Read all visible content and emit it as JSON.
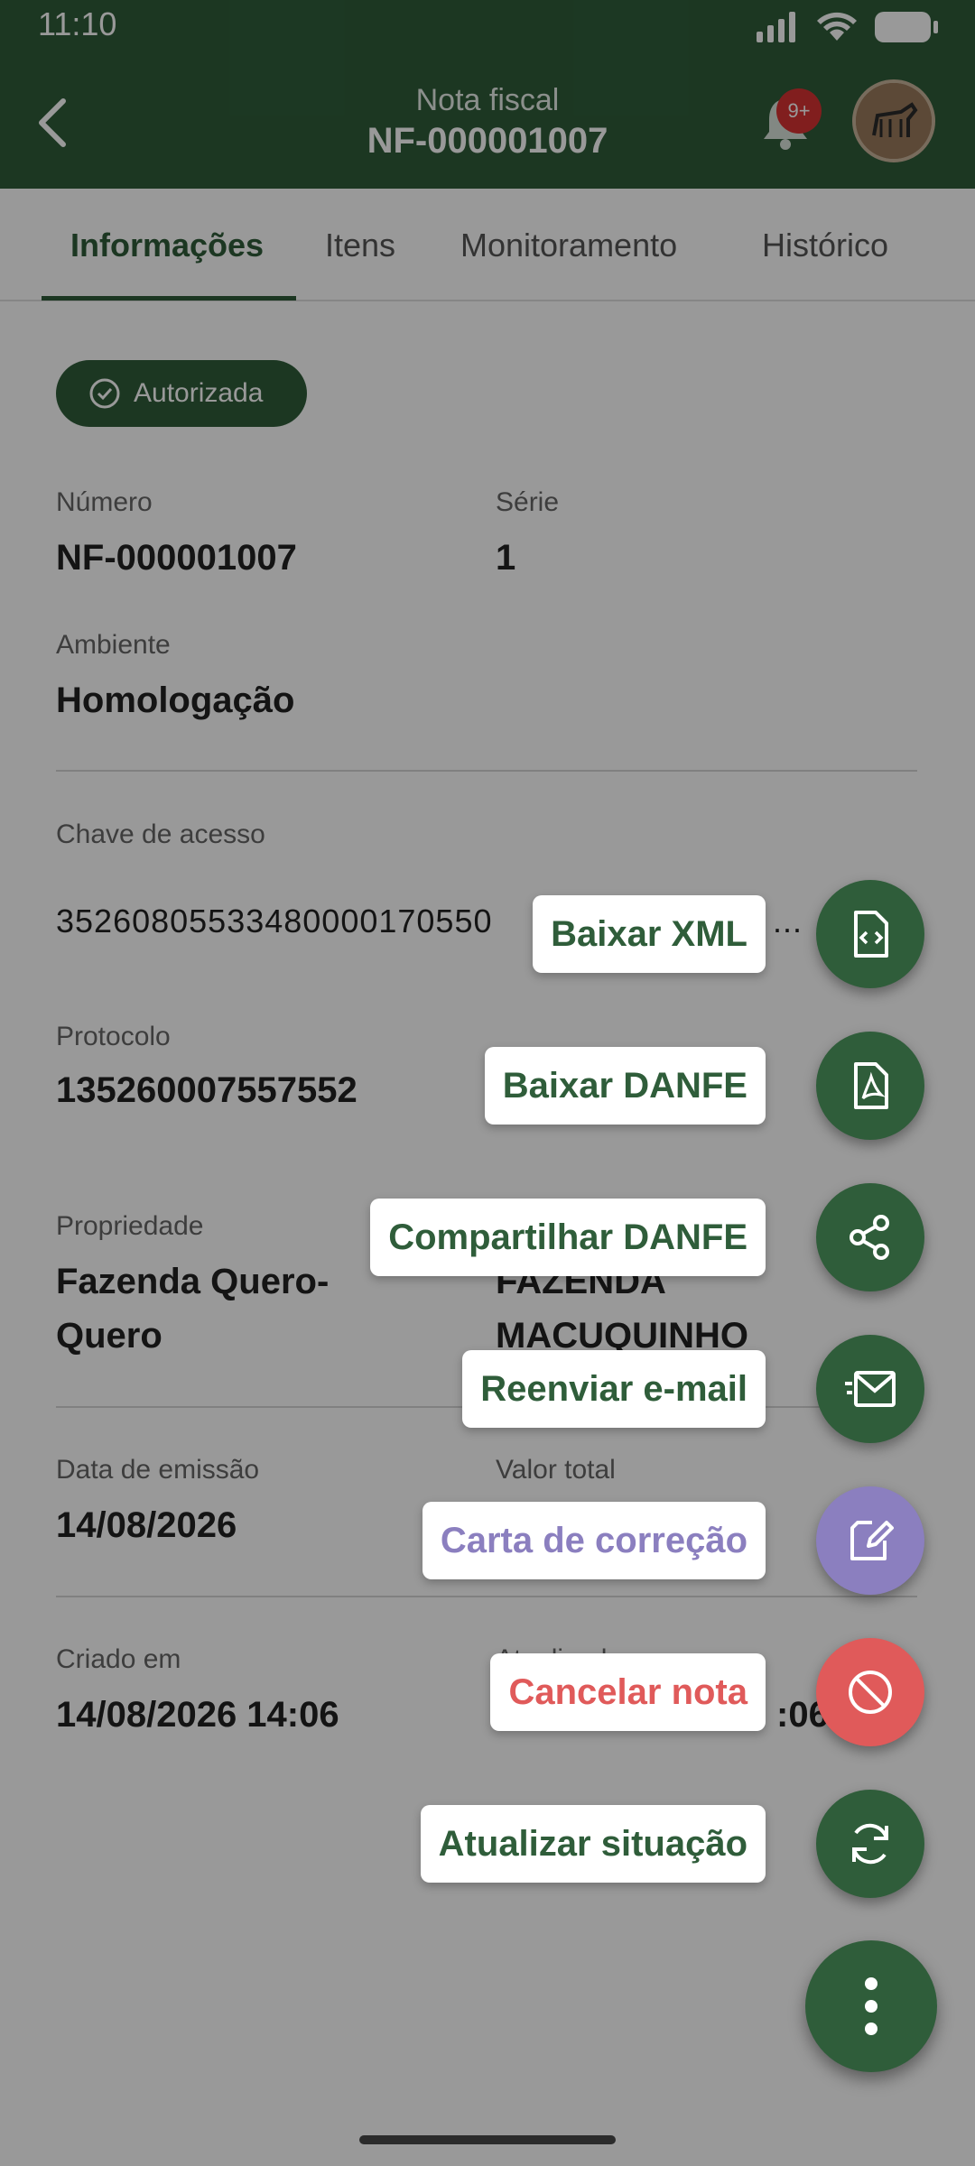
{
  "status_bar": {
    "time": "11:10"
  },
  "header": {
    "title": "Nota fiscal",
    "subtitle": "NF-000001007",
    "notification_badge": "9+"
  },
  "tabs": [
    {
      "label": "Informações",
      "active": true
    },
    {
      "label": "Itens",
      "active": false
    },
    {
      "label": "Monitoramento",
      "active": false
    },
    {
      "label": "Histórico",
      "active": false
    }
  ],
  "status_badge": {
    "label": "Autorizada"
  },
  "fields": {
    "numero": {
      "label": "Número",
      "value": "NF-000001007"
    },
    "serie": {
      "label": "Série",
      "value": "1"
    },
    "ambiente": {
      "label": "Ambiente",
      "value": "Homologação"
    },
    "chave": {
      "label": "Chave de acesso",
      "value": "35260805533480000170550",
      "ellipsis": "..."
    },
    "protocolo": {
      "label": "Protocolo",
      "value": "135260007557552"
    },
    "propriedade": {
      "label": "Propriedade",
      "value_line1": "Fazenda Quero-",
      "value_line2": "Quero"
    },
    "destinatario": {
      "value_line1": "FAZENDA",
      "value_line2": "MACUQUINHO"
    },
    "data_emissao": {
      "label": "Data de emissão",
      "value": "14/08/2026"
    },
    "valor_total": {
      "label": "Valor total"
    },
    "criado_em": {
      "label": "Criado em",
      "value": "14/08/2026 14:06"
    },
    "atualizado_em": {
      "label": "Atualizado em",
      "value_tail": ":06"
    }
  },
  "fab_menu": {
    "items": [
      {
        "label": "Baixar XML",
        "icon": "xml-file-icon"
      },
      {
        "label": "Baixar DANFE",
        "icon": "pdf-file-icon"
      },
      {
        "label": "Compartilhar DANFE",
        "icon": "share-icon"
      },
      {
        "label": "Reenviar e-mail",
        "icon": "send-mail-icon"
      },
      {
        "label": "Carta de correção",
        "icon": "edit-note-icon",
        "color": "#8b7fbf"
      },
      {
        "label": "Cancelar nota",
        "icon": "block-icon",
        "color": "#e05a5a"
      },
      {
        "label": "Atualizar situação",
        "icon": "refresh-icon"
      }
    ],
    "main_icon": "more-vertical-icon"
  },
  "colors": {
    "brand": "#2f5d3a",
    "purple": "#8b7fbf",
    "danger": "#e05a5a",
    "badge": "#d83232"
  }
}
